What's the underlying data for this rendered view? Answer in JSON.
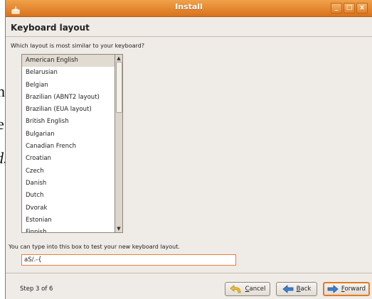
{
  "background_text": [
    "n",
    "e",
    "d."
  ],
  "window": {
    "title": "Install",
    "buttons": {
      "minimize": "_",
      "maximize": "□",
      "close": "x"
    }
  },
  "page": {
    "heading": "Keyboard layout",
    "question": "Which layout is most similar to your keyboard?",
    "layouts": [
      "American English",
      "Belarusian",
      "Belgian",
      "Brazilian (ABNT2 layout)",
      "Brazilian (EUA layout)",
      "British English",
      "Bulgarian",
      "Canadian French",
      "Croatian",
      "Czech",
      "Danish",
      "Dutch",
      "Dvorak",
      "Estonian",
      "Finnish"
    ],
    "selected_layout": "American English",
    "test_hint": "You can type into this box to test your new keyboard layout.",
    "test_value": "aS/.-{"
  },
  "footer": {
    "step": "Step 3 of 6",
    "cancel": "Cancel",
    "back": "Back",
    "forward": "Forward"
  },
  "colors": {
    "titlebar": "#e08a30",
    "accent": "#e57a1f",
    "window_bg": "#efebe7",
    "selection": "#e2dbd2"
  },
  "icons": {
    "app": "install-icon",
    "cancel": "undo-arrow-icon",
    "back": "back-arrow-icon",
    "forward": "forward-arrow-icon"
  }
}
